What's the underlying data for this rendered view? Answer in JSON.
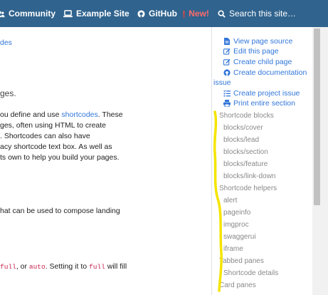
{
  "nav": {
    "community": "Community",
    "example_site": "Example Site",
    "github": "GitHub",
    "new_badge": "New!",
    "search_placeholder": "Search this site…"
  },
  "main": {
    "fragment_link": "des",
    "lead_fragment": "ges.",
    "p1": [
      "ou define and use ",
      "shortcodes",
      ". These",
      "ges, often using HTML to create",
      ". Shortcodes can also have",
      "acy shortcode text box. As well as",
      "ts own to help you build your pages."
    ],
    "p2": "hat can be used to compose landing",
    "p3_code1": "full",
    "p3_sep": ", or ",
    "p3_code2": "auto",
    "p3_mid": ". Setting it to ",
    "p3_code3": "full",
    "p3_end": " will fill"
  },
  "page_links": {
    "view_source": "View page source",
    "edit_page": "Edit this page",
    "create_child": "Create child page",
    "create_doc_issue_1": "Create documentation",
    "create_doc_issue_2": "issue",
    "create_project_issue": "Create project issue",
    "print_section": "Print entire section"
  },
  "toc": [
    {
      "label": "Shortcode blocks",
      "level": 0
    },
    {
      "label": "blocks/cover",
      "level": 1
    },
    {
      "label": "blocks/lead",
      "level": 1
    },
    {
      "label": "blocks/section",
      "level": 1
    },
    {
      "label": "blocks/feature",
      "level": 1
    },
    {
      "label": "blocks/link-down",
      "level": 1
    },
    {
      "label": "Shortcode helpers",
      "level": 0
    },
    {
      "label": "alert",
      "level": 1
    },
    {
      "label": "pageinfo",
      "level": 1
    },
    {
      "label": "imgproc",
      "level": 1
    },
    {
      "label": "swaggerui",
      "level": 1
    },
    {
      "label": "iframe",
      "level": 1
    },
    {
      "label": "Tabbed panes",
      "level": 0
    },
    {
      "label": "Shortcode details",
      "level": 1
    },
    {
      "label": "Card panes",
      "level": 0
    }
  ],
  "colors": {
    "navbar": "#30638e",
    "link": "#3176d9",
    "new_badge": "#ff6b6b",
    "toc_text": "#8a8a8a",
    "annotation": "#f5e400"
  }
}
